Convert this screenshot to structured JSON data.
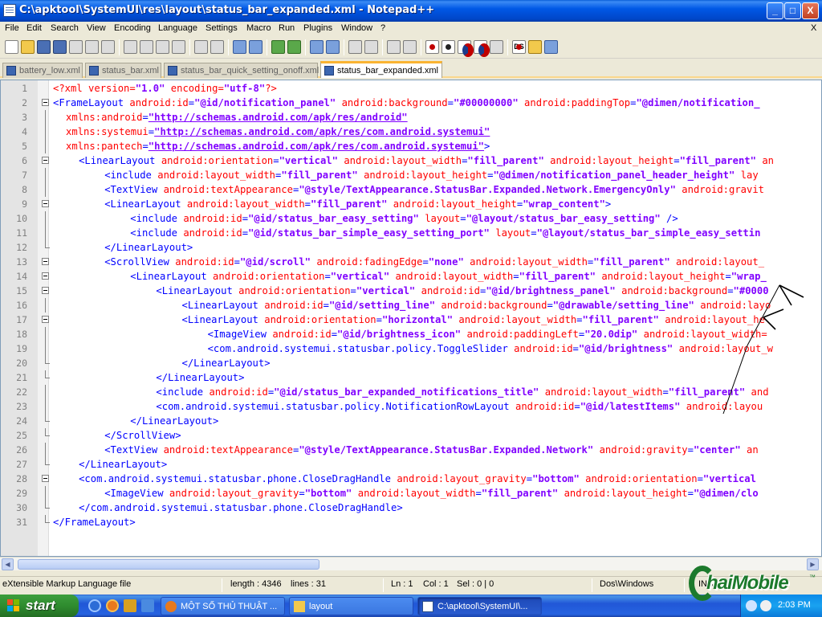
{
  "window": {
    "title": "C:\\apktool\\SystemUI\\res\\layout\\status_bar_expanded.xml - Notepad++",
    "controls": {
      "minimize": "_",
      "maximize": "□",
      "close": "X"
    }
  },
  "menu": [
    "File",
    "Edit",
    "Search",
    "View",
    "Encoding",
    "Language",
    "Settings",
    "Macro",
    "Run",
    "Plugins",
    "Window",
    "?"
  ],
  "menu_close": "X",
  "toolbar": {
    "ds_label": "DS"
  },
  "tabs": [
    {
      "label": "battery_low.xml",
      "active": false
    },
    {
      "label": "status_bar.xml",
      "active": false
    },
    {
      "label": "status_bar_quick_setting_onoff.xml",
      "active": false
    },
    {
      "label": "status_bar_expanded.xml",
      "active": true
    }
  ],
  "code_lines": [
    {
      "n": "1",
      "indent": 0,
      "fold": "",
      "tokens": [
        [
          "pi",
          "<?xml "
        ],
        [
          "a",
          "version"
        ],
        [
          "pi",
          "="
        ],
        [
          "v",
          "\"1.0\""
        ],
        [
          "pi",
          " "
        ],
        [
          "a",
          "encoding"
        ],
        [
          "pi",
          "="
        ],
        [
          "v",
          "\"utf-8\""
        ],
        [
          "pi",
          "?>"
        ]
      ]
    },
    {
      "n": "2",
      "indent": 0,
      "fold": "open",
      "tokens": [
        [
          "t",
          "<FrameLayout "
        ],
        [
          "a",
          "android:id"
        ],
        [
          "t",
          "="
        ],
        [
          "v",
          "\"@id/notification_panel\""
        ],
        [
          "t",
          " "
        ],
        [
          "a",
          "android:background"
        ],
        [
          "t",
          "="
        ],
        [
          "v",
          "\"#00000000\""
        ],
        [
          "t",
          " "
        ],
        [
          "a",
          "android:paddingTop"
        ],
        [
          "t",
          "="
        ],
        [
          "v",
          "\"@dimen/notification_"
        ]
      ]
    },
    {
      "n": "3",
      "indent": 1,
      "fold": "",
      "tokens": [
        [
          "a",
          "xmlns:android"
        ],
        [
          "t",
          "="
        ],
        [
          "lnk",
          "\"http://schemas.android.com/apk/res/android\""
        ]
      ]
    },
    {
      "n": "4",
      "indent": 1,
      "fold": "",
      "tokens": [
        [
          "a",
          "xmlns:systemui"
        ],
        [
          "t",
          "="
        ],
        [
          "lnk",
          "\"http://schemas.android.com/apk/res/com.android.systemui\""
        ]
      ]
    },
    {
      "n": "5",
      "indent": 1,
      "fold": "",
      "tokens": [
        [
          "a",
          "xmlns:pantech"
        ],
        [
          "t",
          "="
        ],
        [
          "lnk",
          "\"http://schemas.android.com/apk/res/com.android.systemui\""
        ],
        [
          "t",
          ">"
        ]
      ]
    },
    {
      "n": "6",
      "indent": 2,
      "fold": "open",
      "tokens": [
        [
          "t",
          "<LinearLayout "
        ],
        [
          "a",
          "android:orientation"
        ],
        [
          "t",
          "="
        ],
        [
          "v",
          "\"vertical\""
        ],
        [
          "t",
          " "
        ],
        [
          "a",
          "android:layout_width"
        ],
        [
          "t",
          "="
        ],
        [
          "v",
          "\"fill_parent\""
        ],
        [
          "t",
          " "
        ],
        [
          "a",
          "android:layout_height"
        ],
        [
          "t",
          "="
        ],
        [
          "v",
          "\"fill_parent\""
        ],
        [
          "t",
          " "
        ],
        [
          "a",
          "an"
        ]
      ]
    },
    {
      "n": "7",
      "indent": 4,
      "fold": "",
      "tokens": [
        [
          "t",
          "<include "
        ],
        [
          "a",
          "android:layout_width"
        ],
        [
          "t",
          "="
        ],
        [
          "v",
          "\"fill_parent\""
        ],
        [
          "t",
          " "
        ],
        [
          "a",
          "android:layout_height"
        ],
        [
          "t",
          "="
        ],
        [
          "v",
          "\"@dimen/notification_panel_header_height\""
        ],
        [
          "t",
          " "
        ],
        [
          "a",
          "lay"
        ]
      ]
    },
    {
      "n": "8",
      "indent": 4,
      "fold": "",
      "tokens": [
        [
          "t",
          "<TextView "
        ],
        [
          "a",
          "android:textAppearance"
        ],
        [
          "t",
          "="
        ],
        [
          "v",
          "\"@style/TextAppearance.StatusBar.Expanded.Network.EmergencyOnly\""
        ],
        [
          "t",
          " "
        ],
        [
          "a",
          "android:gravit"
        ]
      ]
    },
    {
      "n": "9",
      "indent": 4,
      "fold": "open",
      "tokens": [
        [
          "t",
          "<LinearLayout "
        ],
        [
          "a",
          "android:layout_width"
        ],
        [
          "t",
          "="
        ],
        [
          "v",
          "\"fill_parent\""
        ],
        [
          "t",
          " "
        ],
        [
          "a",
          "android:layout_height"
        ],
        [
          "t",
          "="
        ],
        [
          "v",
          "\"wrap_content\""
        ],
        [
          "t",
          ">"
        ]
      ]
    },
    {
      "n": "10",
      "indent": 6,
      "fold": "",
      "tokens": [
        [
          "t",
          "<include "
        ],
        [
          "a",
          "android:id"
        ],
        [
          "t",
          "="
        ],
        [
          "v",
          "\"@id/status_bar_easy_setting\""
        ],
        [
          "t",
          " "
        ],
        [
          "a",
          "layout"
        ],
        [
          "t",
          "="
        ],
        [
          "v",
          "\"@layout/status_bar_easy_setting\""
        ],
        [
          "t",
          " />"
        ]
      ]
    },
    {
      "n": "11",
      "indent": 6,
      "fold": "",
      "tokens": [
        [
          "t",
          "<include "
        ],
        [
          "a",
          "android:id"
        ],
        [
          "t",
          "="
        ],
        [
          "v",
          "\"@id/status_bar_simple_easy_setting_port\""
        ],
        [
          "t",
          " "
        ],
        [
          "a",
          "layout"
        ],
        [
          "t",
          "="
        ],
        [
          "v",
          "\"@layout/status_bar_simple_easy_settin"
        ]
      ]
    },
    {
      "n": "12",
      "indent": 4,
      "fold": "end",
      "tokens": [
        [
          "t",
          "</LinearLayout>"
        ]
      ]
    },
    {
      "n": "13",
      "indent": 4,
      "fold": "open",
      "tokens": [
        [
          "t",
          "<ScrollView "
        ],
        [
          "a",
          "android:id"
        ],
        [
          "t",
          "="
        ],
        [
          "v",
          "\"@id/scroll\""
        ],
        [
          "t",
          " "
        ],
        [
          "a",
          "android:fadingEdge"
        ],
        [
          "t",
          "="
        ],
        [
          "v",
          "\"none\""
        ],
        [
          "t",
          " "
        ],
        [
          "a",
          "android:layout_width"
        ],
        [
          "t",
          "="
        ],
        [
          "v",
          "\"fill_parent\""
        ],
        [
          "t",
          " "
        ],
        [
          "a",
          "android:layout_"
        ]
      ]
    },
    {
      "n": "14",
      "indent": 6,
      "fold": "open",
      "tokens": [
        [
          "t",
          "<LinearLayout "
        ],
        [
          "a",
          "android:orientation"
        ],
        [
          "t",
          "="
        ],
        [
          "v",
          "\"vertical\""
        ],
        [
          "t",
          " "
        ],
        [
          "a",
          "android:layout_width"
        ],
        [
          "t",
          "="
        ],
        [
          "v",
          "\"fill_parent\""
        ],
        [
          "t",
          " "
        ],
        [
          "a",
          "android:layout_height"
        ],
        [
          "t",
          "="
        ],
        [
          "v",
          "\"wrap_"
        ]
      ]
    },
    {
      "n": "15",
      "indent": 8,
      "fold": "open",
      "tokens": [
        [
          "t",
          "<LinearLayout "
        ],
        [
          "a",
          "android:orientation"
        ],
        [
          "t",
          "="
        ],
        [
          "v",
          "\"vertical\""
        ],
        [
          "t",
          " "
        ],
        [
          "a",
          "android:id"
        ],
        [
          "t",
          "="
        ],
        [
          "v",
          "\"@id/brightness_panel\""
        ],
        [
          "t",
          " "
        ],
        [
          "a",
          "android:background"
        ],
        [
          "t",
          "="
        ],
        [
          "v",
          "\"#0000"
        ]
      ]
    },
    {
      "n": "16",
      "indent": 10,
      "fold": "",
      "tokens": [
        [
          "t",
          "<LinearLayout "
        ],
        [
          "a",
          "android:id"
        ],
        [
          "t",
          "="
        ],
        [
          "v",
          "\"@id/setting_line\""
        ],
        [
          "t",
          " "
        ],
        [
          "a",
          "android:background"
        ],
        [
          "t",
          "="
        ],
        [
          "v",
          "\"@drawable/setting_line\""
        ],
        [
          "t",
          " "
        ],
        [
          "a",
          "android:layo"
        ]
      ]
    },
    {
      "n": "17",
      "indent": 10,
      "fold": "open",
      "tokens": [
        [
          "t",
          "<LinearLayout "
        ],
        [
          "a",
          "android:orientation"
        ],
        [
          "t",
          "="
        ],
        [
          "v",
          "\"horizontal\""
        ],
        [
          "t",
          " "
        ],
        [
          "a",
          "android:layout_width"
        ],
        [
          "t",
          "="
        ],
        [
          "v",
          "\"fill_parent\""
        ],
        [
          "t",
          " "
        ],
        [
          "a",
          "android:layout_he"
        ]
      ]
    },
    {
      "n": "18",
      "indent": 12,
      "fold": "",
      "tokens": [
        [
          "t",
          "<ImageView "
        ],
        [
          "a",
          "android:id"
        ],
        [
          "t",
          "="
        ],
        [
          "v",
          "\"@id/brightness_icon\""
        ],
        [
          "t",
          " "
        ],
        [
          "a",
          "android:paddingLeft"
        ],
        [
          "t",
          "="
        ],
        [
          "v",
          "\"20.0dip\""
        ],
        [
          "t",
          " "
        ],
        [
          "a",
          "android:layout_width="
        ]
      ]
    },
    {
      "n": "19",
      "indent": 12,
      "fold": "",
      "tokens": [
        [
          "t",
          "<com.android.systemui.statusbar.policy.ToggleSlider "
        ],
        [
          "a",
          "android:id"
        ],
        [
          "t",
          "="
        ],
        [
          "v",
          "\"@id/brightness\""
        ],
        [
          "t",
          " "
        ],
        [
          "a",
          "android:layout_w"
        ]
      ]
    },
    {
      "n": "20",
      "indent": 10,
      "fold": "end",
      "tokens": [
        [
          "t",
          "</LinearLayout>"
        ]
      ]
    },
    {
      "n": "21",
      "indent": 8,
      "fold": "end",
      "tokens": [
        [
          "t",
          "</LinearLayout>"
        ]
      ]
    },
    {
      "n": "22",
      "indent": 8,
      "fold": "",
      "tokens": [
        [
          "t",
          "<include "
        ],
        [
          "a",
          "android:id"
        ],
        [
          "t",
          "="
        ],
        [
          "v",
          "\"@id/status_bar_expanded_notifications_title\""
        ],
        [
          "t",
          " "
        ],
        [
          "a",
          "android:layout_width"
        ],
        [
          "t",
          "="
        ],
        [
          "v",
          "\"fill_parent\""
        ],
        [
          "t",
          " "
        ],
        [
          "a",
          "and"
        ]
      ]
    },
    {
      "n": "23",
      "indent": 8,
      "fold": "",
      "tokens": [
        [
          "t",
          "<com.android.systemui.statusbar.policy.NotificationRowLayout "
        ],
        [
          "a",
          "android:id"
        ],
        [
          "t",
          "="
        ],
        [
          "v",
          "\"@id/latestItems\""
        ],
        [
          "t",
          " "
        ],
        [
          "a",
          "android:layou"
        ]
      ]
    },
    {
      "n": "24",
      "indent": 6,
      "fold": "end",
      "tokens": [
        [
          "t",
          "</LinearLayout>"
        ]
      ]
    },
    {
      "n": "25",
      "indent": 4,
      "fold": "end",
      "tokens": [
        [
          "t",
          "</ScrollView>"
        ]
      ]
    },
    {
      "n": "26",
      "indent": 4,
      "fold": "",
      "tokens": [
        [
          "t",
          "<TextView "
        ],
        [
          "a",
          "android:textAppearance"
        ],
        [
          "t",
          "="
        ],
        [
          "v",
          "\"@style/TextAppearance.StatusBar.Expanded.Network\""
        ],
        [
          "t",
          " "
        ],
        [
          "a",
          "android:gravity"
        ],
        [
          "t",
          "="
        ],
        [
          "v",
          "\"center\""
        ],
        [
          "t",
          " "
        ],
        [
          "a",
          "an"
        ]
      ]
    },
    {
      "n": "27",
      "indent": 2,
      "fold": "end",
      "tokens": [
        [
          "t",
          "</LinearLayout>"
        ]
      ]
    },
    {
      "n": "28",
      "indent": 2,
      "fold": "open",
      "tokens": [
        [
          "t",
          "<com.android.systemui.statusbar.phone.CloseDragHandle "
        ],
        [
          "a",
          "android:layout_gravity"
        ],
        [
          "t",
          "="
        ],
        [
          "v",
          "\"bottom\""
        ],
        [
          "t",
          " "
        ],
        [
          "a",
          "android:orientation"
        ],
        [
          "t",
          "="
        ],
        [
          "v",
          "\"vertical"
        ]
      ]
    },
    {
      "n": "29",
      "indent": 4,
      "fold": "",
      "tokens": [
        [
          "t",
          "<ImageView "
        ],
        [
          "a",
          "android:layout_gravity"
        ],
        [
          "t",
          "="
        ],
        [
          "v",
          "\"bottom\""
        ],
        [
          "t",
          " "
        ],
        [
          "a",
          "android:layout_width"
        ],
        [
          "t",
          "="
        ],
        [
          "v",
          "\"fill_parent\""
        ],
        [
          "t",
          " "
        ],
        [
          "a",
          "android:layout_height"
        ],
        [
          "t",
          "="
        ],
        [
          "v",
          "\"@dimen/clo"
        ]
      ]
    },
    {
      "n": "30",
      "indent": 2,
      "fold": "end",
      "tokens": [
        [
          "t",
          "</com.android.systemui.statusbar.phone.CloseDragHandle>"
        ]
      ]
    },
    {
      "n": "31",
      "indent": 0,
      "fold": "end",
      "tokens": [
        [
          "t",
          "</FrameLayout>"
        ]
      ]
    }
  ],
  "status": {
    "file_type": "eXtensible Markup Language file",
    "length": "length : 4346",
    "lines": "lines : 31",
    "ln": "Ln : 1",
    "col": "Col : 1",
    "sel": "Sel : 0 | 0",
    "eol": "Dos\\Windows",
    "ins": "INS"
  },
  "taskbar": {
    "start": "start",
    "tasks": [
      {
        "label": "MỘT SỐ THỦ THUẬT ...",
        "icon": "firefox-icon",
        "active": false
      },
      {
        "label": "layout",
        "icon": "folder-icon",
        "active": false
      },
      {
        "label": "C:\\apktool\\SystemUI\\...",
        "icon": "notepad-icon",
        "active": true
      }
    ],
    "clock": "2:03 PM"
  },
  "watermark": {
    "text": "haiMobile",
    "tm": "™"
  },
  "colors": {
    "tag": "#0000ff",
    "attr": "#ff0000",
    "value": "#8000ff",
    "tab_accent": "#fab432"
  }
}
